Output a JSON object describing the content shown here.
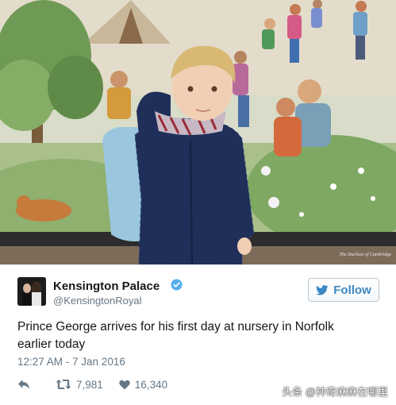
{
  "photo": {
    "credit": "The Duchess of Cambridge",
    "alt_subject": "child-with-backpack-in-front-of-mural"
  },
  "tweet": {
    "display_name": "Kensington Palace",
    "handle": "@KensingtonRoyal",
    "verified": true,
    "follow_label": "Follow",
    "text": "Prince George arrives for his first day at nursery in Norfolk earlier today",
    "timestamp": "12:27 AM - 7 Jan 2016",
    "retweets": "7,981",
    "likes": "16,340"
  },
  "watermark": "头条 @神奇麻麻在哪里",
  "colors": {
    "accent": "#3b88c3",
    "text_primary": "#14171a",
    "text_secondary": "#657786",
    "verified": "#55acee"
  },
  "icons": [
    "verified-icon",
    "twitter-bird-icon",
    "reply-icon",
    "retweet-icon",
    "heart-icon"
  ]
}
